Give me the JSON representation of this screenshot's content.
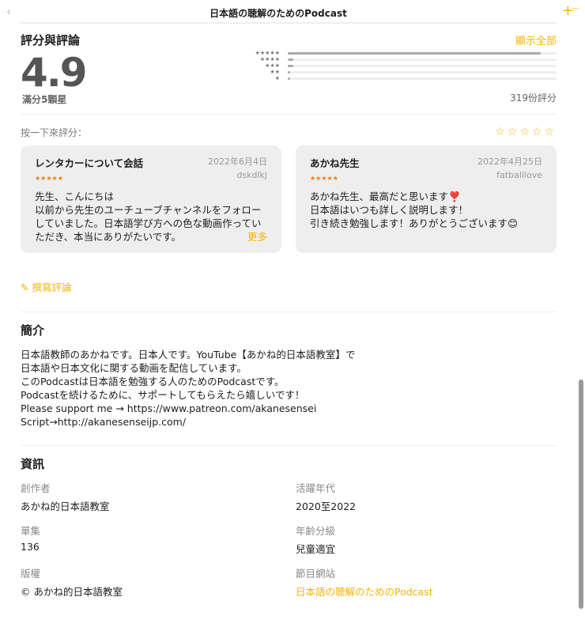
{
  "header": {
    "title": "日本語の聴解のためのPodcast",
    "back_icon": "chevron-left-icon",
    "add_icon": "plus-icon",
    "more_icon": "ellipsis-icon"
  },
  "ratings": {
    "heading": "評分與評論",
    "show_all": "顯示全部",
    "score": "4.9",
    "out_of": "滿分5顆星",
    "count": "319份評分",
    "histogram": [
      {
        "stars": "★★★★★",
        "fraction": 0.94
      },
      {
        "stars": "★★★★",
        "fraction": 0.02
      },
      {
        "stars": "★★★",
        "fraction": 0.02
      },
      {
        "stars": "★★",
        "fraction": 0.01
      },
      {
        "stars": "★",
        "fraction": 0.01
      }
    ],
    "tap_label": "按一下來評分：",
    "tap_stars": "☆☆☆☆☆"
  },
  "reviews": [
    {
      "title": "レンタカーについて会話",
      "date": "2022年6月4日",
      "author": "dskdlkj",
      "stars": "★★★★★",
      "body": "先生、こんにちは\n以前から先生のユーチューブチャンネルをフォローしていました。日本語学び方への色な動画作っていただき、本当にありがたいです。",
      "more": "更多"
    },
    {
      "title": "あかね先生",
      "date": "2022年4月25日",
      "author": "fatballlove",
      "stars": "★★★★★",
      "body": "あかね先生、最高だと思います❣️\n日本語はいつも詳しく説明します！\n引き続き勉強します！ありがとうございます😊"
    }
  ],
  "write_review": "撰寫評論",
  "about": {
    "heading": "簡介",
    "text": "日本語教師のあかねです。日本人です。YouTube【あかね的日本語教室】で\n日本語や日本文化に関する動画を配信しています。\nこのPodcastは日本語を勉強する人のためのPodcastです。\nPodcastを続けるために、サポートしてもらえたら嬉しいです！\nPlease support me → https://www.patreon.com/akanesensei\nScript→http://akanesenseijp.com/"
  },
  "info": {
    "heading": "資訊",
    "items": [
      {
        "label": "創作者",
        "value": "あかね的日本語教室"
      },
      {
        "label": "活躍年代",
        "value": "2020至2022"
      },
      {
        "label": "單集",
        "value": "136"
      },
      {
        "label": "年齡分級",
        "value": "兒童適宜"
      },
      {
        "label": "版權",
        "value": "© あかね的日本語教室"
      },
      {
        "label": "節目網站",
        "value": "日本語の聴解のためのPodcast"
      }
    ]
  }
}
